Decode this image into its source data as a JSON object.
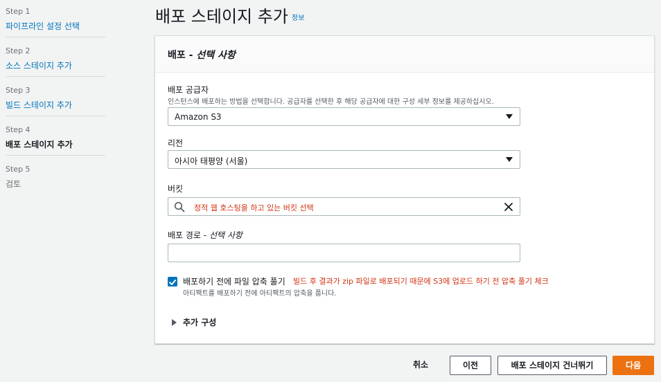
{
  "steps": [
    {
      "num": "Step 1",
      "label": "파이프라인 설정 선택"
    },
    {
      "num": "Step 2",
      "label": "소스 스테이지 추가"
    },
    {
      "num": "Step 3",
      "label": "빌드 스테이지 추가"
    },
    {
      "num": "Step 4",
      "label": "배포 스테이지 추가"
    },
    {
      "num": "Step 5",
      "label": "검토"
    }
  ],
  "page": {
    "title": "배포 스테이지 추가",
    "info_link": "정보"
  },
  "panel": {
    "title_main": "배포 - ",
    "title_opt": "선택 사항"
  },
  "provider": {
    "label": "배포 공급자",
    "desc": "인스턴스에 배포하는 방법을 선택합니다. 공급자를 선택한 후 해당 공급자에 대한 구성 세부 정보를 제공하십시오.",
    "value": "Amazon S3"
  },
  "region": {
    "label": "리전",
    "value": "아시아 태평양 (서울)"
  },
  "bucket": {
    "label": "버킷",
    "annotation": "정적 웹 호스팅을 하고 있는 버킷 선택"
  },
  "deploy_path": {
    "label_main": "배포 경로 - ",
    "label_opt": "선택 사항",
    "value": ""
  },
  "extract": {
    "checked": true,
    "label": "배포하기 전에 파일 압축 풀기",
    "annotation": "빌드 후 결과가 zip 파일로 배포되기 때문에 S3에 업로드 하기 전 압축 풀기 체크",
    "desc": "아티팩트를 배포하기 전에 아티팩트의 압축을 풉니다."
  },
  "additional_config": {
    "label": "추가 구성"
  },
  "footer": {
    "cancel": "취소",
    "previous": "이전",
    "skip": "배포 스테이지 건너뛰기",
    "next": "다음"
  },
  "colors": {
    "accent": "#0073bb",
    "primary_button": "#ec7211",
    "annotation": "#d13212"
  }
}
